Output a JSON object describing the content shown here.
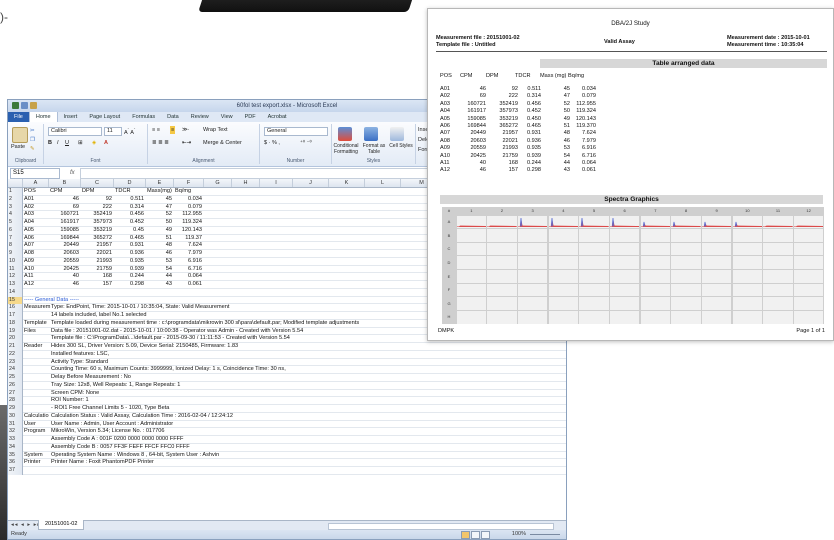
{
  "background": {
    "left_text_fragment": ")-"
  },
  "excel": {
    "title": "60fol test export.xlsx - Microsoft Excel",
    "tabs": [
      "File",
      "Home",
      "Insert",
      "Page Layout",
      "Formulas",
      "Data",
      "Review",
      "View",
      "PDF",
      "Acrobat"
    ],
    "ribbon": {
      "clipboard": {
        "label": "Clipboard",
        "paste": "Paste"
      },
      "font": {
        "label": "Font",
        "name": "Calibri",
        "size": "11"
      },
      "alignment": {
        "label": "Alignment",
        "wrap": "Wrap Text",
        "merge": "Merge & Center"
      },
      "number": {
        "label": "Number",
        "format": "General"
      },
      "styles": {
        "label": "Styles",
        "cond": "Conditional Formatting",
        "table": "Format as Table",
        "cell": "Cell Styles"
      },
      "cells": {
        "insert": "Insert",
        "delete": "Delete",
        "format": "Format"
      }
    },
    "name_box": "S15",
    "fx": "fx",
    "columns": [
      "A",
      "B",
      "C",
      "D",
      "E",
      "F",
      "G",
      "H",
      "I",
      "J",
      "K",
      "L",
      "M",
      "N"
    ],
    "rows": [
      {
        "n": "1",
        "a": "POS",
        "b": "CPM",
        "c": "DPM",
        "d": "TDCR",
        "e": "Mass(mg)",
        "f": "Bq/mg"
      },
      {
        "n": "2",
        "a": "A01",
        "b": "46",
        "c": "92",
        "d": "0.511",
        "e": "45",
        "f": "0.034"
      },
      {
        "n": "3",
        "a": "A02",
        "b": "69",
        "c": "222",
        "d": "0.314",
        "e": "47",
        "f": "0.079"
      },
      {
        "n": "4",
        "a": "A03",
        "b": "160721",
        "c": "352419",
        "d": "0.456",
        "e": "52",
        "f": "112.955"
      },
      {
        "n": "5",
        "a": "A04",
        "b": "161917",
        "c": "357973",
        "d": "0.452",
        "e": "50",
        "f": "119.324"
      },
      {
        "n": "6",
        "a": "A05",
        "b": "159085",
        "c": "353219",
        "d": "0.45",
        "e": "49",
        "f": "120.143"
      },
      {
        "n": "7",
        "a": "A06",
        "b": "169844",
        "c": "365272",
        "d": "0.465",
        "e": "51",
        "f": "119.37"
      },
      {
        "n": "8",
        "a": "A07",
        "b": "20449",
        "c": "21957",
        "d": "0.931",
        "e": "48",
        "f": "7.624"
      },
      {
        "n": "9",
        "a": "A08",
        "b": "20603",
        "c": "22021",
        "d": "0.936",
        "e": "46",
        "f": "7.979"
      },
      {
        "n": "10",
        "a": "A09",
        "b": "20559",
        "c": "21993",
        "d": "0.935",
        "e": "53",
        "f": "6.916"
      },
      {
        "n": "11",
        "a": "A10",
        "b": "20425",
        "c": "21759",
        "d": "0.939",
        "e": "54",
        "f": "6.716"
      },
      {
        "n": "12",
        "a": "A11",
        "b": "40",
        "c": "168",
        "d": "0.244",
        "e": "44",
        "f": "0.064"
      },
      {
        "n": "13",
        "a": "A12",
        "b": "46",
        "c": "157",
        "d": "0.298",
        "e": "43",
        "f": "0.061"
      },
      {
        "n": "14",
        "a": "",
        "b": "",
        "c": "",
        "d": "",
        "e": "",
        "f": ""
      }
    ],
    "text_rows": [
      {
        "n": "15",
        "a": "----- General Data -----",
        "rest": ""
      },
      {
        "n": "16",
        "a": "Measurem",
        "rest": "Type: EndPoint, Time: 2015-10-01 / 10:35:04, State: Valid Measurement"
      },
      {
        "n": "17",
        "a": "",
        "rest": "14 labels included, label No.1 selected"
      },
      {
        "n": "18",
        "a": "Template",
        "rest": "Template loaded during measurement time : c:\\programdata\\mikrowin 300 sl\\para\\default.par; Modified template adjustments"
      },
      {
        "n": "19",
        "a": "Files",
        "rest": "Data file : 20151001-02.dat - 2015-10-01 / 10:00:38 - Operator was Admin - Created with Version 5.54"
      },
      {
        "n": "20",
        "a": "",
        "rest": "Template file : C:\\ProgramData\\...\\default.par - 2015-09-30 / 11:11:53 - Created with Version 5.54"
      },
      {
        "n": "21",
        "a": "Reader",
        "rest": "Hidex 300 SL, Driver Version: 5.09, Device Serial: 2150485, Firmware: 1.83"
      },
      {
        "n": "22",
        "a": "",
        "rest": "Installed features: LSC,"
      },
      {
        "n": "23",
        "a": "",
        "rest": "Activity Type: Standard"
      },
      {
        "n": "24",
        "a": "",
        "rest": "Counting Time: 60 s, Maximum Counts: 3999999, Ionized Delay: 1 s, Coincidence Time: 30 ns,"
      },
      {
        "n": "25",
        "a": "",
        "rest": "Delay Before Measurement : No"
      },
      {
        "n": "26",
        "a": "",
        "rest": "Tray Size: 12x8, Well Repeats: 1, Range Repeats: 1"
      },
      {
        "n": "27",
        "a": "",
        "rest": "Screen CPM: None"
      },
      {
        "n": "28",
        "a": "",
        "rest": "ROI Number: 1"
      },
      {
        "n": "29",
        "a": "",
        "rest": "- ROI1 Free Channel Limits 5 - 1020, Type Beta"
      },
      {
        "n": "30",
        "a": "Calculatio",
        "rest": "Calculation Status : Valid Assay, Calculation Time : 2016-02-04 / 12:24:12"
      },
      {
        "n": "31",
        "a": "User",
        "rest": "User Name : Admin, User Account : Administrator"
      },
      {
        "n": "32",
        "a": "Program",
        "rest": "MikroWin, Version 5.34; License No. : 017706"
      },
      {
        "n": "33",
        "a": "",
        "rest": "Assembly Code A : 001F 0200 0000 0000 0000 FFFF"
      },
      {
        "n": "34",
        "a": "",
        "rest": "Assembly Code B : 0057 FF3F FEFF FFCF FFC0 FFFF"
      },
      {
        "n": "35",
        "a": "System",
        "rest": "Operating System Name : Windows 8 , 64-bit, System User : Ashvin"
      },
      {
        "n": "36",
        "a": "Printer",
        "rest": "Printer Name : Foxit PhantomPDF Printer"
      },
      {
        "n": "37",
        "a": "",
        "rest": ""
      }
    ],
    "sheet_tab": "20151001-02",
    "status": {
      "ready": "Ready",
      "zoom": "100%"
    }
  },
  "report": {
    "title": "DBA/2J Study",
    "measurement_file": "Measurement file : 20151001-02",
    "template_file": "Template file :     Untitled",
    "valid": "Valid Assay",
    "measurement_date": "Measurement date : 2015-10-01",
    "measurement_time": "Measurement time : 10:35:04",
    "table_title": "Table arranged data",
    "headers": [
      "POS",
      "CPM",
      "DPM",
      "TDCR",
      "Mass (mg)",
      "Bq/mg"
    ],
    "rows": [
      [
        "A01",
        "46",
        "92",
        "0.511",
        "45",
        "0.034"
      ],
      [
        "A02",
        "69",
        "222",
        "0.314",
        "47",
        "0.079"
      ],
      [
        "A03",
        "160721",
        "352419",
        "0.456",
        "52",
        "112.955"
      ],
      [
        "A04",
        "161917",
        "357973",
        "0.452",
        "50",
        "119.324"
      ],
      [
        "A05",
        "159085",
        "353219",
        "0.450",
        "49",
        "120.143"
      ],
      [
        "A06",
        "169844",
        "365272",
        "0.465",
        "51",
        "119.370"
      ],
      [
        "A07",
        "20449",
        "21957",
        "0.931",
        "48",
        "7.624"
      ],
      [
        "A08",
        "20603",
        "22021",
        "0.936",
        "46",
        "7.979"
      ],
      [
        "A09",
        "20559",
        "21993",
        "0.935",
        "53",
        "6.916"
      ],
      [
        "A10",
        "20425",
        "21759",
        "0.939",
        "54",
        "6.716"
      ],
      [
        "A11",
        "40",
        "168",
        "0.244",
        "44",
        "0.064"
      ],
      [
        "A12",
        "46",
        "157",
        "0.298",
        "43",
        "0.061"
      ]
    ],
    "spectra_title": "Spectra Graphics",
    "plate_cols": [
      "#",
      "1",
      "2",
      "3",
      "4",
      "5",
      "6",
      "7",
      "8",
      "9",
      "10",
      "11",
      "12"
    ],
    "plate_rows": [
      "A",
      "B",
      "C",
      "D",
      "E",
      "F",
      "G",
      "H"
    ],
    "spectra_levels": [
      0.12,
      0.12,
      1,
      1,
      1,
      1,
      0.55,
      0.55,
      0.55,
      0.55,
      0.1,
      0.1
    ],
    "footer_left": "DMPK",
    "footer_right": "Page 1 of 1",
    "accent_color": "#d93a3a",
    "peak_color": "#5a6fd6"
  }
}
